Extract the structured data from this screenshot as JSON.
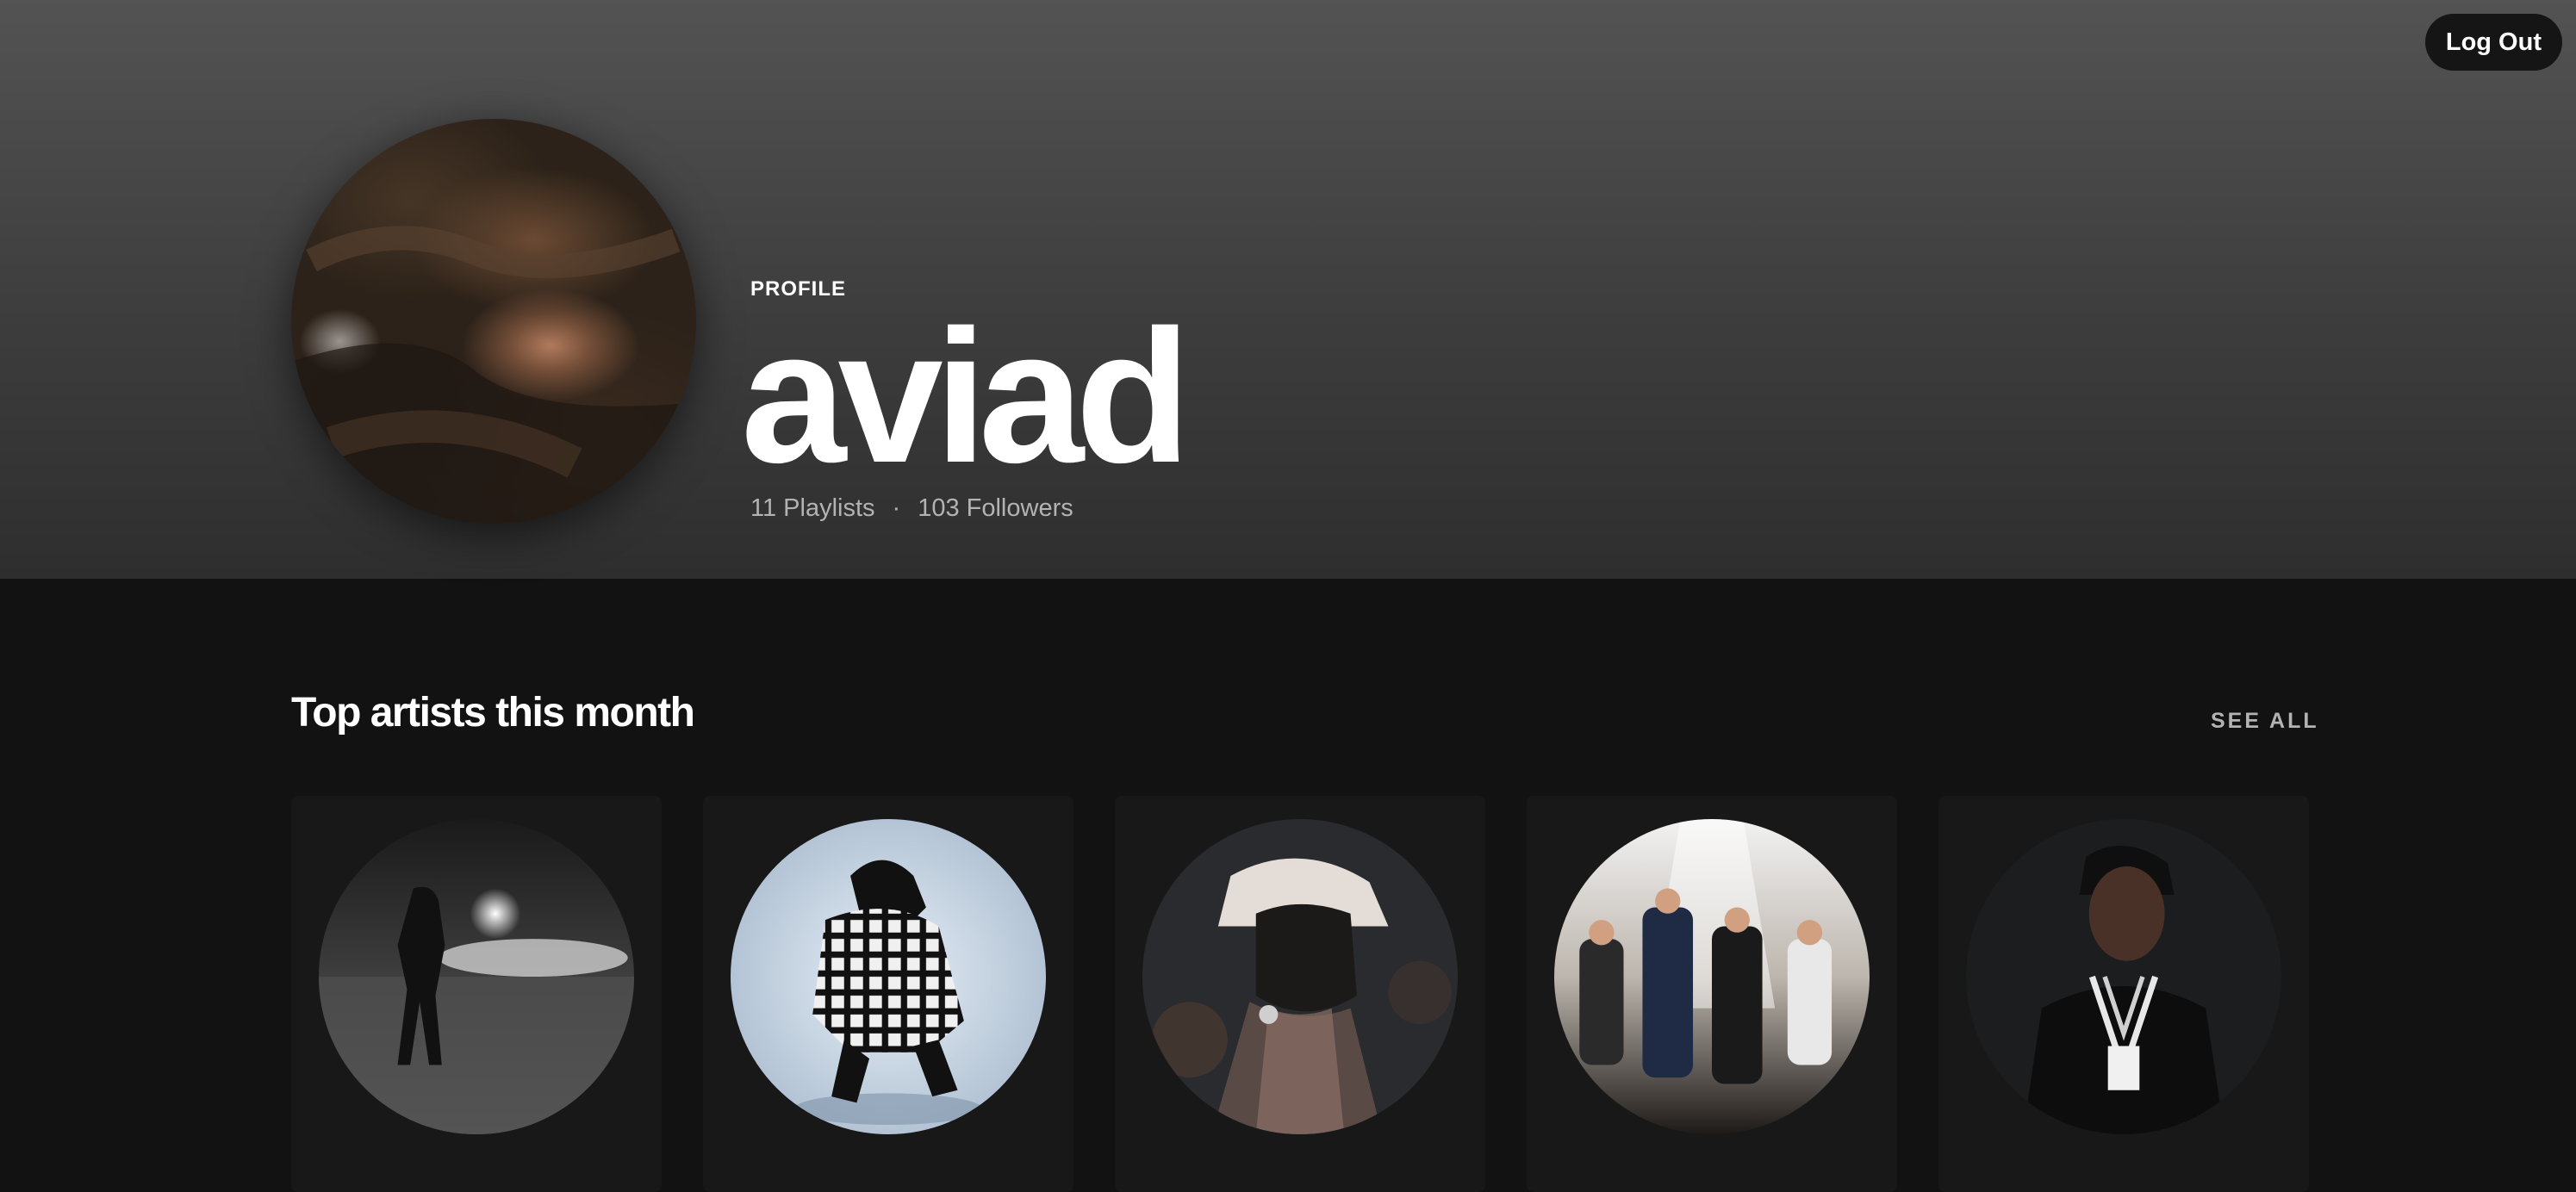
{
  "header": {
    "logout_label": "Log Out",
    "profile_label": "PROFILE",
    "username": "aviad",
    "playlists": "11 Playlists",
    "separator": "·",
    "followers": "103 Followers"
  },
  "top_artists": {
    "title": "Top artists this month",
    "see_all_label": "SEE ALL",
    "artists": [
      {
        "image": "artist-photo-night-field"
      },
      {
        "image": "artist-photo-plaid-jacket"
      },
      {
        "image": "artist-photo-bucket-hat"
      },
      {
        "image": "artist-photo-band"
      },
      {
        "image": "artist-photo-chains"
      }
    ]
  },
  "colors": {
    "header_top": "#535353",
    "header_bottom": "#2e2e2e",
    "page_bg": "#121212",
    "card_bg": "#181818",
    "muted_text": "#b3b3b3"
  }
}
